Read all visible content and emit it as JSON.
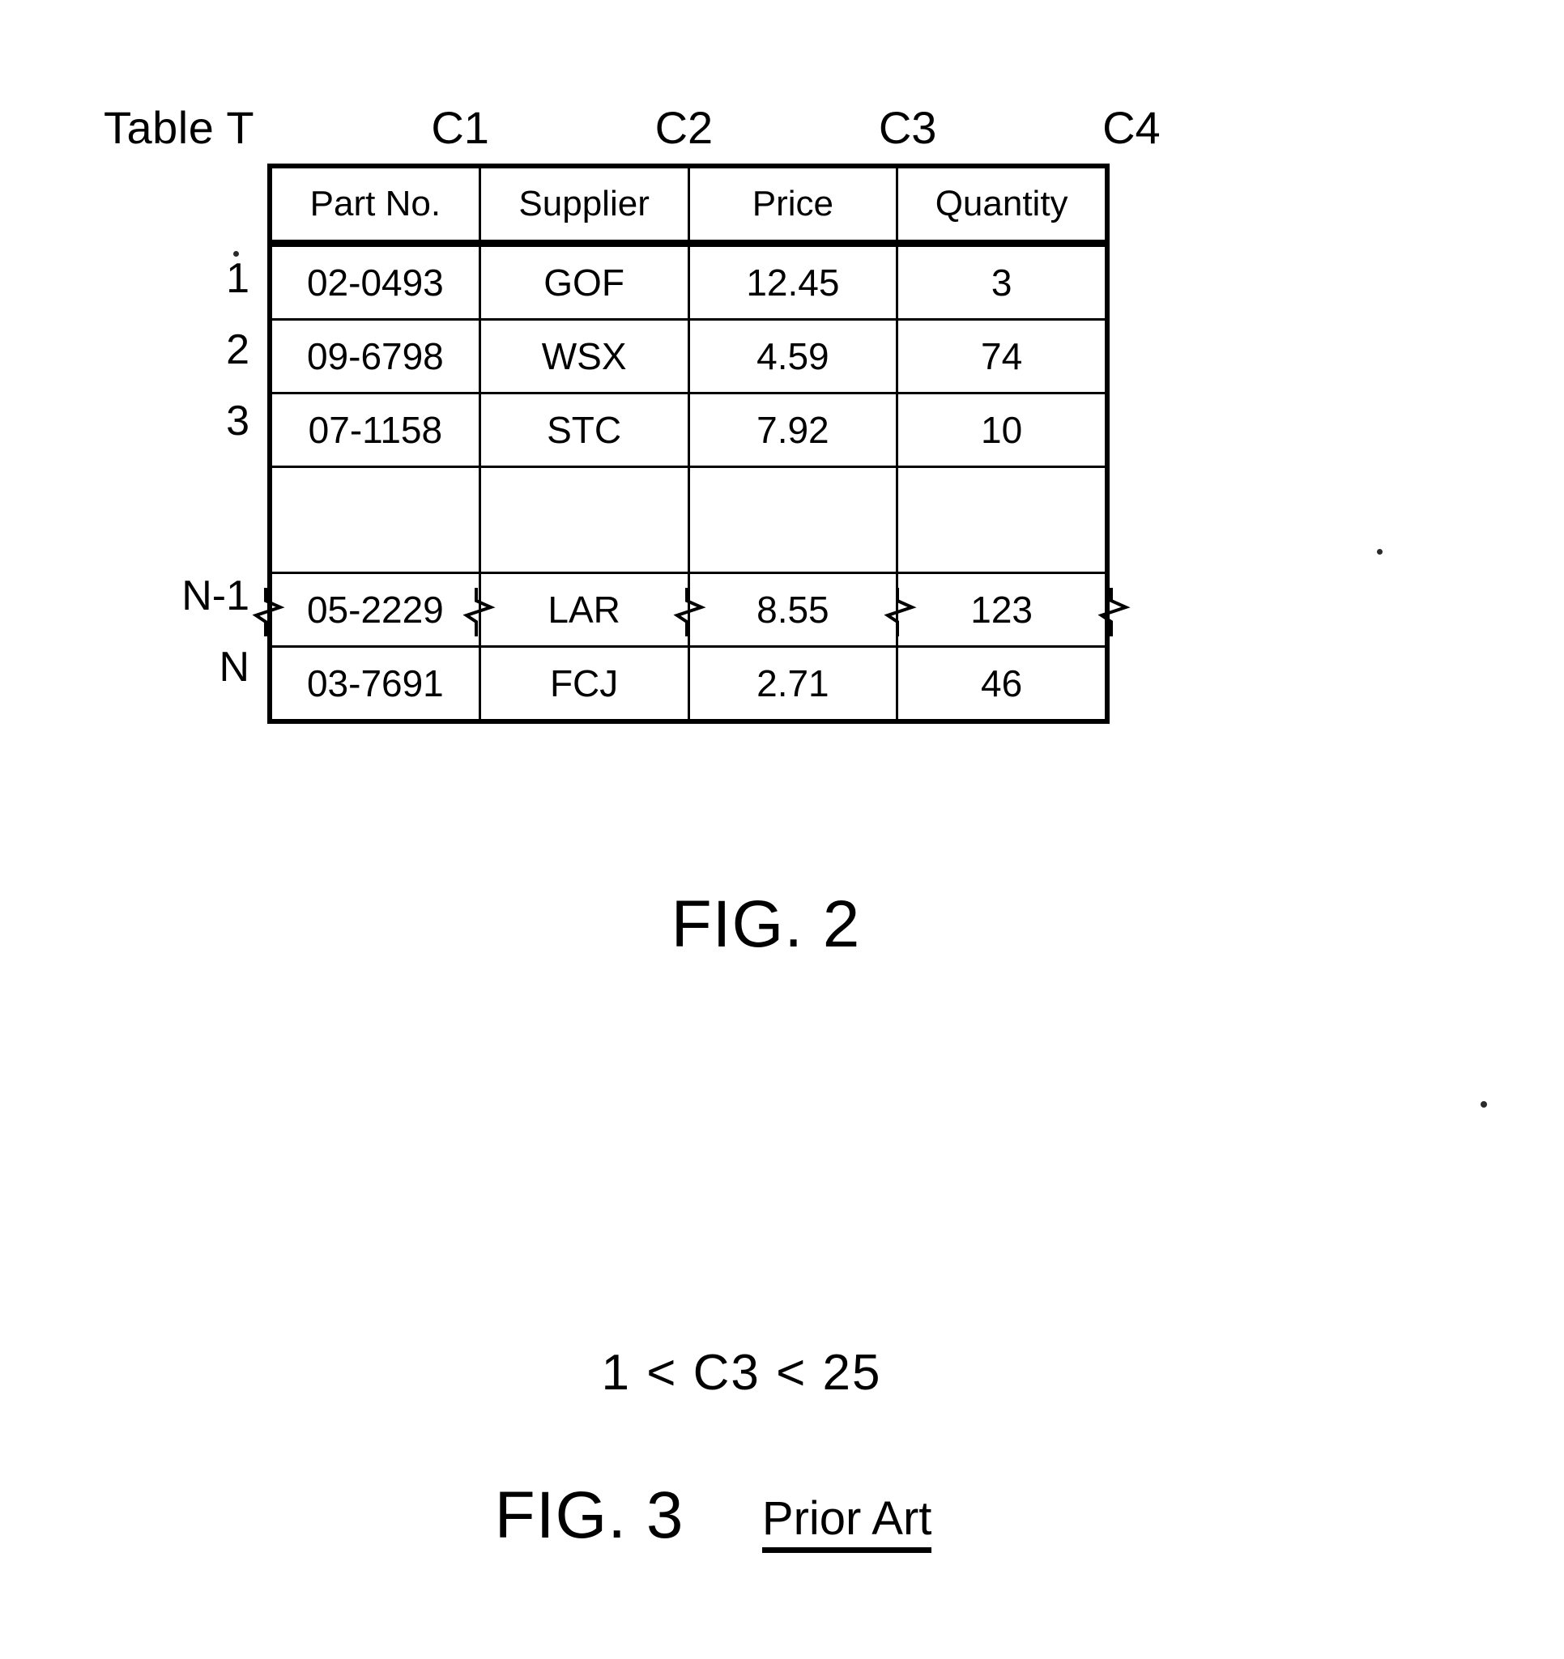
{
  "figure2": {
    "table_label": "Table T",
    "column_ids": [
      "C1",
      "C2",
      "C3",
      "C4"
    ],
    "column_headers": [
      "Part No.",
      "Supplier",
      "Price",
      "Quantity"
    ],
    "row_ids": [
      "1",
      "2",
      "3",
      "N-1",
      "N"
    ],
    "rows": [
      {
        "row_id": "1",
        "part_no": "02-0493",
        "supplier": "GOF",
        "price": "12.45",
        "quantity": "3"
      },
      {
        "row_id": "2",
        "part_no": "09-6798",
        "supplier": "WSX",
        "price": "4.59",
        "quantity": "74"
      },
      {
        "row_id": "3",
        "part_no": "07-1158",
        "supplier": "STC",
        "price": "7.92",
        "quantity": "10"
      },
      {
        "row_id": "N-1",
        "part_no": "05-2229",
        "supplier": "LAR",
        "price": "8.55",
        "quantity": "123"
      },
      {
        "row_id": "N",
        "part_no": "03-7691",
        "supplier": "FCJ",
        "price": "2.71",
        "quantity": "46"
      }
    ],
    "break_row": {
      "label": "",
      "note": ""
    },
    "caption": "FIG. 2"
  },
  "figure3": {
    "expression": "1 < C3 < 25",
    "caption": "FIG. 3",
    "annotation": "Prior Art"
  },
  "colors": {
    "ink": "#000000",
    "paper": "#ffffff"
  }
}
